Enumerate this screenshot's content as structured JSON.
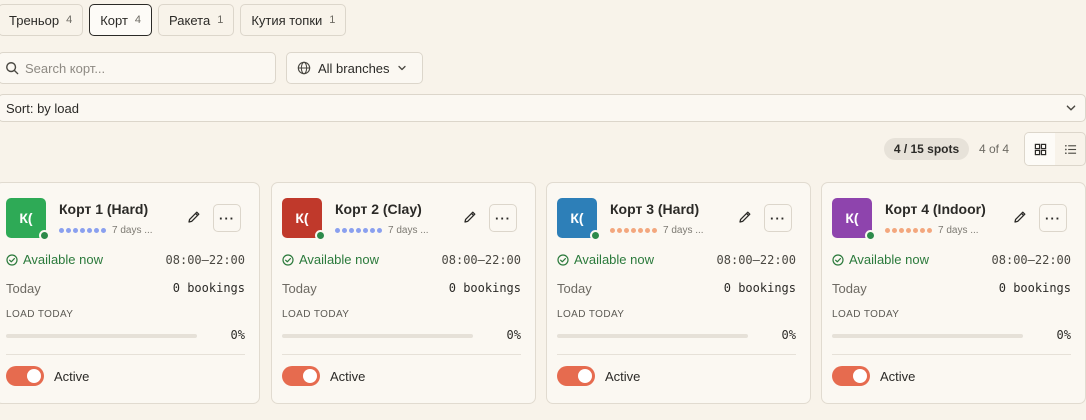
{
  "tabs": [
    {
      "label": "Треньор",
      "count": "4",
      "active": false
    },
    {
      "label": "Корт",
      "count": "4",
      "active": true
    },
    {
      "label": "Ракета",
      "count": "1",
      "active": false
    },
    {
      "label": "Кутия топки",
      "count": "1",
      "active": false
    }
  ],
  "search": {
    "placeholder": "Search корт..."
  },
  "branches": {
    "label": "All branches"
  },
  "sort": {
    "label": "Sort: by load"
  },
  "toolbar": {
    "spots": "4 / 15 spots",
    "page_count": "4 of 4",
    "view": "grid"
  },
  "cards": [
    {
      "initials": "К(",
      "title": "Корт 1 (Hard)",
      "avatar_color": "#2eaa56",
      "dot_color": "#8aa0ef",
      "days": "7 days ...",
      "status": "Available now",
      "hours": "08:00—22:00",
      "today_label": "Today",
      "bookings": "0 bookings",
      "load_label": "LOAD TODAY",
      "load_pct": "0%",
      "load_fraction": 0,
      "active_label": "Active",
      "active": true
    },
    {
      "initials": "К(",
      "title": "Корт 2 (Clay)",
      "avatar_color": "#c0392b",
      "dot_color": "#8aa0ef",
      "days": "7 days ...",
      "status": "Available now",
      "hours": "08:00—22:00",
      "today_label": "Today",
      "bookings": "0 bookings",
      "load_label": "LOAD TODAY",
      "load_pct": "0%",
      "load_fraction": 0,
      "active_label": "Active",
      "active": true
    },
    {
      "initials": "К(",
      "title": "Корт 3 (Hard)",
      "avatar_color": "#2d7fb8",
      "dot_color": "#f3a77e",
      "days": "7 days ...",
      "status": "Available now",
      "hours": "08:00—22:00",
      "today_label": "Today",
      "bookings": "0 bookings",
      "load_label": "LOAD TODAY",
      "load_pct": "0%",
      "load_fraction": 0,
      "active_label": "Active",
      "active": true
    },
    {
      "initials": "К(",
      "title": "Корт 4 (Indoor)",
      "avatar_color": "#8e44ad",
      "dot_color": "#f3a77e",
      "days": "7 days ...",
      "status": "Available now",
      "hours": "08:00—22:00",
      "today_label": "Today",
      "bookings": "0 bookings",
      "load_label": "LOAD TODAY",
      "load_pct": "0%",
      "load_fraction": 0,
      "active_label": "Active",
      "active": true
    }
  ],
  "icons": {
    "search": "search-icon",
    "globe": "globe-icon",
    "chevron": "chevron-down-icon",
    "grid": "grid-view-icon",
    "list": "list-view-icon",
    "edit": "pencil-icon",
    "more": "more-horizontal-icon",
    "status": "check-circle-icon"
  }
}
